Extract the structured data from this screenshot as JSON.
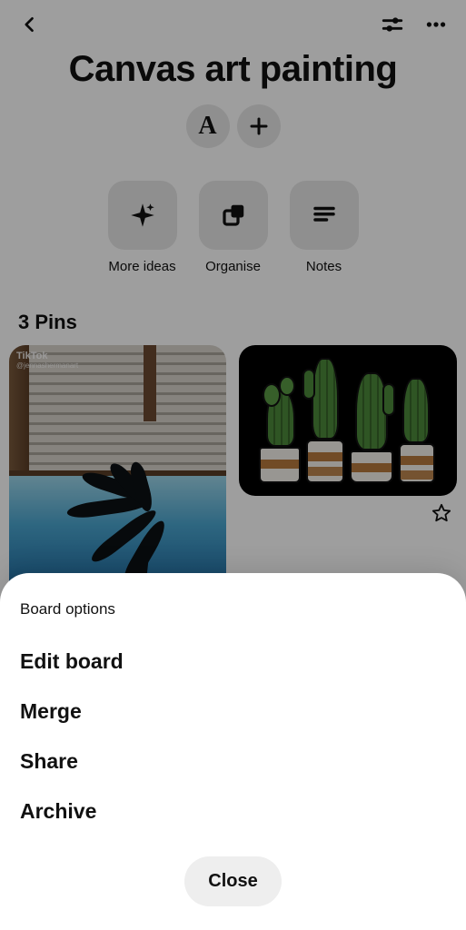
{
  "header": {
    "title": "Canvas art painting"
  },
  "chips": {
    "letter": "A"
  },
  "actions": [
    {
      "label": "More ideas"
    },
    {
      "label": "Organise"
    },
    {
      "label": "Notes"
    }
  ],
  "pins": {
    "count_label": "3 Pins",
    "pin1_watermark": "TikTok",
    "pin1_user": "@jennashermanart"
  },
  "sheet": {
    "title": "Board options",
    "items": [
      "Edit board",
      "Merge",
      "Share",
      "Archive"
    ],
    "close": "Close"
  }
}
